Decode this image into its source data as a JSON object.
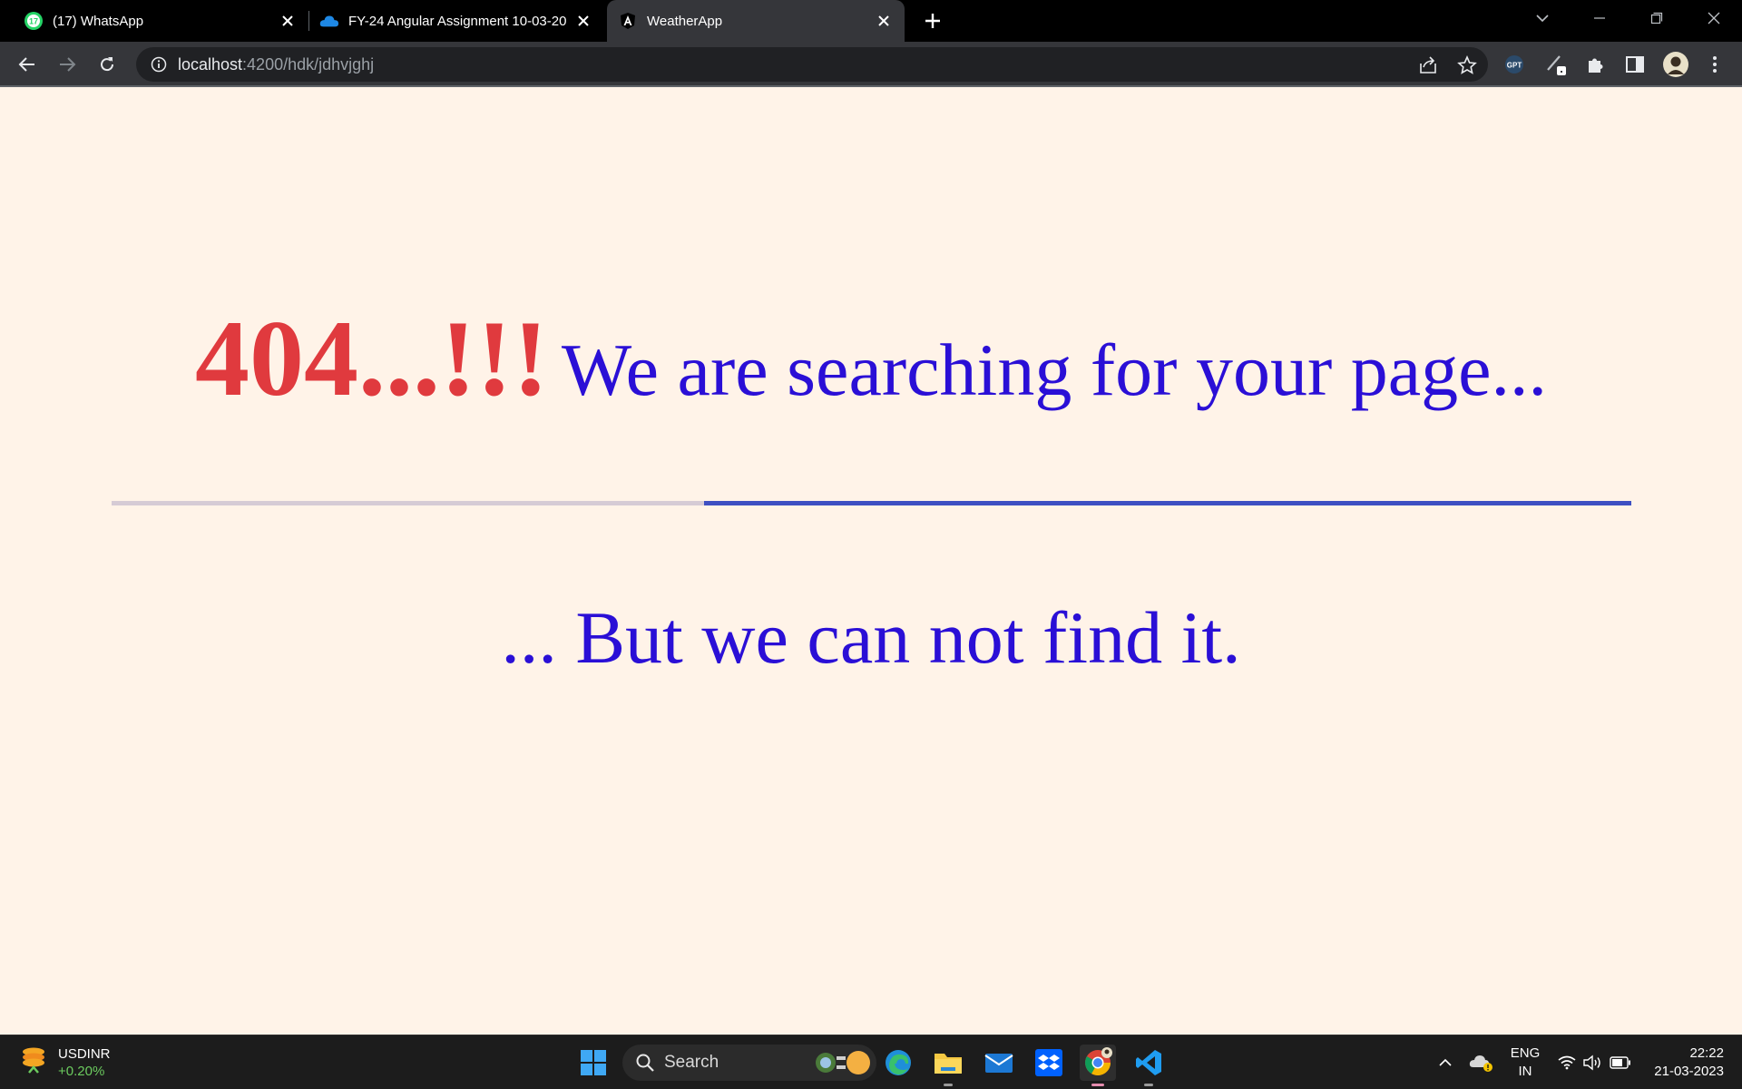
{
  "browser": {
    "tabs": [
      {
        "title": "(17) WhatsApp",
        "badge": "17",
        "icon": "whatsapp-icon",
        "active": false
      },
      {
        "title": "FY-24 Angular Assignment 10-03-20",
        "icon": "onedrive-icon",
        "active": false
      },
      {
        "title": "WeatherApp",
        "icon": "angular-icon",
        "active": true
      }
    ],
    "url_host": "localhost",
    "url_rest": ":4200/hdk/jdhvjghj"
  },
  "page": {
    "code": "404...!!!",
    "headline": "We are searching for your page...",
    "subline": "... But we can not find it.",
    "progress_fraction": 0.61,
    "colors": {
      "code": "#e03a3e",
      "text": "#2a0fd6",
      "bar_fill": "#3e4fc2",
      "bar_track": "#d6cbd5",
      "background": "#fff3e8"
    }
  },
  "taskbar": {
    "widget": {
      "symbol": "USDINR",
      "change": "+0.20%"
    },
    "search_label": "Search",
    "lang_top": "ENG",
    "lang_bottom": "IN",
    "time": "22:22",
    "date": "21-03-2023"
  }
}
